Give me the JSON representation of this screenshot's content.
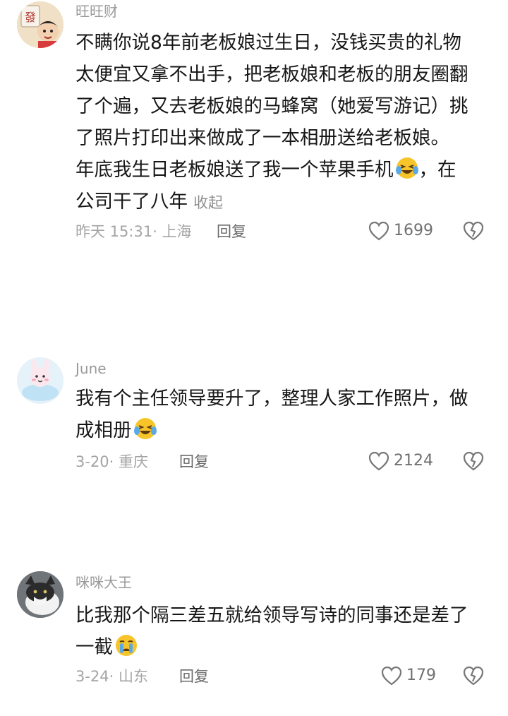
{
  "comments": [
    {
      "author": "旺旺财",
      "lines": [
        "不瞒你说8年前老板娘过生日，没钱买贵的礼物",
        "太便宜又拿不出手，把老板娘和老板的朋友圈翻",
        "了个遍，又去老板娘的马蜂窝（她爱写游记）挑",
        "了照片打印出来做成了一本相册送给老板娘。",
        "年底我生日老板娘送了我一个苹果手机",
        "，在",
        "公司干了八年"
      ],
      "collapse_label": "收起",
      "meta": "昨天 15:31· 上海",
      "reply_label": "回复",
      "likes": "1699",
      "emoji_icon": "crying-laughing-emoji-icon"
    },
    {
      "author": "June",
      "lines": [
        "我有个主任领导要升了，整理人家工作照片，做",
        "成相册"
      ],
      "meta": "3-20· 重庆",
      "reply_label": "回复",
      "likes": "2124",
      "emoji_icon": "crying-laughing-emoji-icon"
    },
    {
      "author": "咪咪大王",
      "lines": [
        "比我那个隔三差五就给领导写诗的同事还是差了",
        "一截"
      ],
      "meta": "3-24· 山东",
      "reply_label": "回复",
      "likes": "179",
      "emoji_icon": "crying-emoji-icon"
    }
  ],
  "colors": {
    "text": "#161616",
    "secondary": "#9a9a9a",
    "emoji_yellow": "#f7c52a",
    "tear_blue": "#5aa9e6"
  }
}
